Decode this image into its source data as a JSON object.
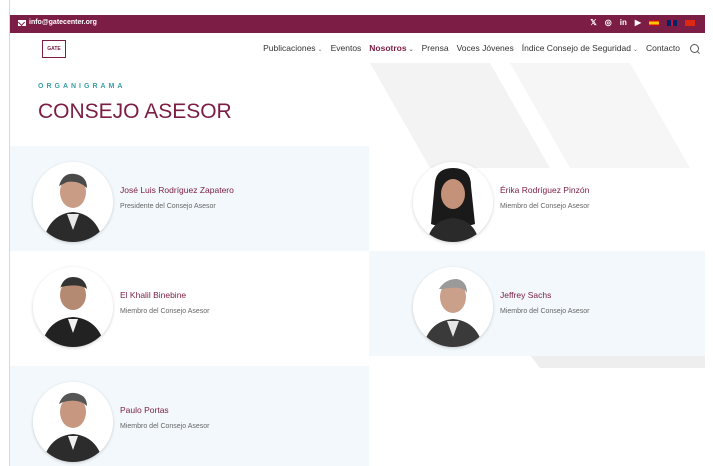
{
  "topbar": {
    "email": "info@gatecenter.org",
    "social_icons": [
      "x-icon",
      "instagram-icon",
      "linkedin-icon",
      "youtube-icon"
    ],
    "languages": [
      "es",
      "en",
      "cn"
    ]
  },
  "logo": {
    "text": "GATE"
  },
  "nav": {
    "items": [
      {
        "label": "Publicaciones",
        "dropdown": true
      },
      {
        "label": "Eventos",
        "dropdown": false
      },
      {
        "label": "Nosotros",
        "dropdown": true,
        "active": true
      },
      {
        "label": "Prensa",
        "dropdown": false
      },
      {
        "label": "Voces Jóvenes",
        "dropdown": false
      },
      {
        "label": "Índice Consejo de Seguridad",
        "dropdown": true
      },
      {
        "label": "Contacto",
        "dropdown": false
      }
    ]
  },
  "page": {
    "kicker": "ORGANIGRAMA",
    "title": "CONSEJO ASESOR"
  },
  "members": [
    {
      "name": "José Luis Rodríguez Zapatero",
      "role": "Presidente del Consejo Asesor"
    },
    {
      "name": "Érika Rodríguez Pinzón",
      "role": "Miembro del Consejo Asesor"
    },
    {
      "name": "El Khalil Binebine",
      "role": "Miembro del Consejo Asesor"
    },
    {
      "name": "Jeffrey Sachs",
      "role": "Miembro del Consejo Asesor"
    },
    {
      "name": "Paulo Portas",
      "role": "Miembro del Consejo Asesor"
    }
  ],
  "colors": {
    "brand": "#7b1d44",
    "accent": "#3aa0a6",
    "card_bg": "#f2f8fc"
  }
}
